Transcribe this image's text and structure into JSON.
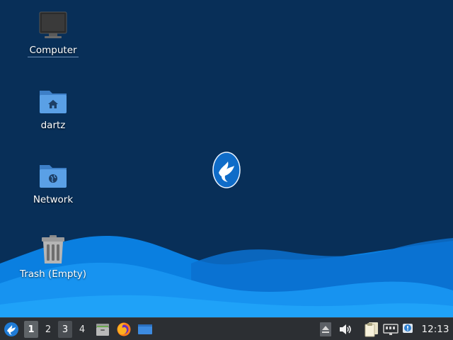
{
  "desktop": {
    "background_color": "#082f58",
    "wave_colors": [
      "#0a7fe0",
      "#1a9cf5",
      "#086bd0"
    ],
    "icons": [
      {
        "label": "Computer",
        "icon": "computer-monitor-icon"
      },
      {
        "label": "dartz",
        "icon": "home-folder-icon"
      },
      {
        "label": "Network",
        "icon": "network-folder-icon"
      },
      {
        "label": "Trash (Empty)",
        "icon": "trash-icon"
      }
    ],
    "center_logo": "xubuntu-bird-logo"
  },
  "panel": {
    "background_color": "#2c2f33",
    "menu_icon": "xubuntu-menu-icon",
    "workspaces": [
      "1",
      "2",
      "3",
      "4"
    ],
    "launchers": [
      {
        "name": "files",
        "icon": "file-manager-icon"
      },
      {
        "name": "firefox",
        "icon": "firefox-icon"
      },
      {
        "name": "show-desktop",
        "icon": "show-desktop-icon"
      }
    ],
    "tray": [
      {
        "name": "eject",
        "icon": "eject-icon"
      },
      {
        "name": "volume",
        "icon": "volume-icon"
      },
      {
        "name": "clipboard",
        "icon": "clipboard-icon"
      },
      {
        "name": "network",
        "icon": "network-wired-icon"
      },
      {
        "name": "notifications",
        "icon": "notification-icon"
      }
    ],
    "clock": "12:13"
  }
}
